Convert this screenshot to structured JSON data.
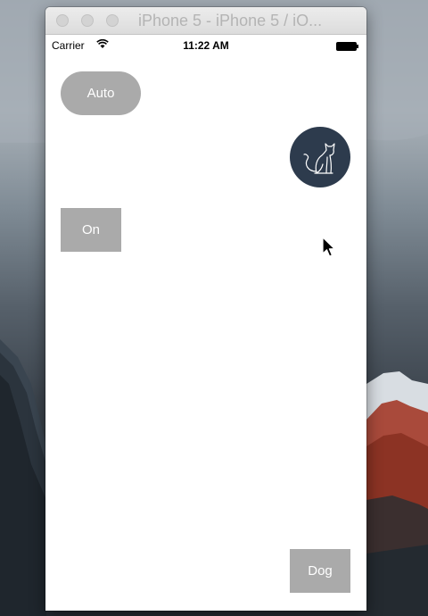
{
  "window": {
    "title": "iPhone 5 - iPhone 5 / iO..."
  },
  "status_bar": {
    "carrier": "Carrier",
    "time": "11:22 AM"
  },
  "buttons": {
    "auto_label": "Auto",
    "on_label": "On",
    "dog_label": "Dog"
  },
  "icons": {
    "cat_button": "cat-icon",
    "wifi": "wifi-icon",
    "battery": "battery-icon",
    "cursor": "mouse-pointer-icon"
  },
  "colors": {
    "button_gray": "#aaaaaa",
    "cat_circle": "#2d3b4d",
    "screen_bg": "#ffffff"
  }
}
